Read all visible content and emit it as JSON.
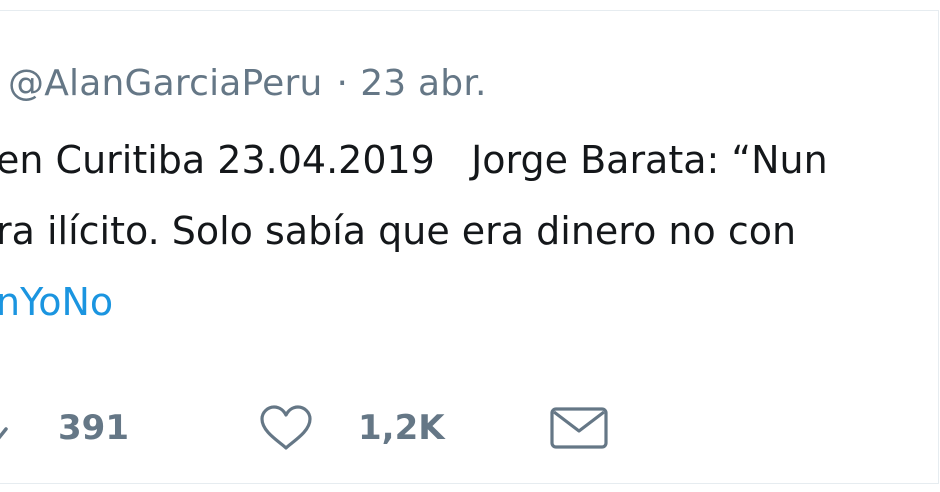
{
  "tweet": {
    "handle": "@AlanGarciaPeru",
    "separator": "·",
    "date": "23 abr.",
    "text_line_1": "en Curitiba 23.04.2019   Jorge Barata: “Nun",
    "text_line_2": "ra ilícito. Solo sabía que era dinero no con",
    "hashtag": "nYoNo"
  },
  "actions": {
    "retweet_count": "391",
    "like_count": "1,2K"
  },
  "icons": {
    "retweet": "retweet-icon",
    "like": "heart-icon",
    "message": "envelope-icon"
  },
  "colors": {
    "muted": "#657786",
    "text": "#14171a",
    "link": "#1b95e0"
  }
}
